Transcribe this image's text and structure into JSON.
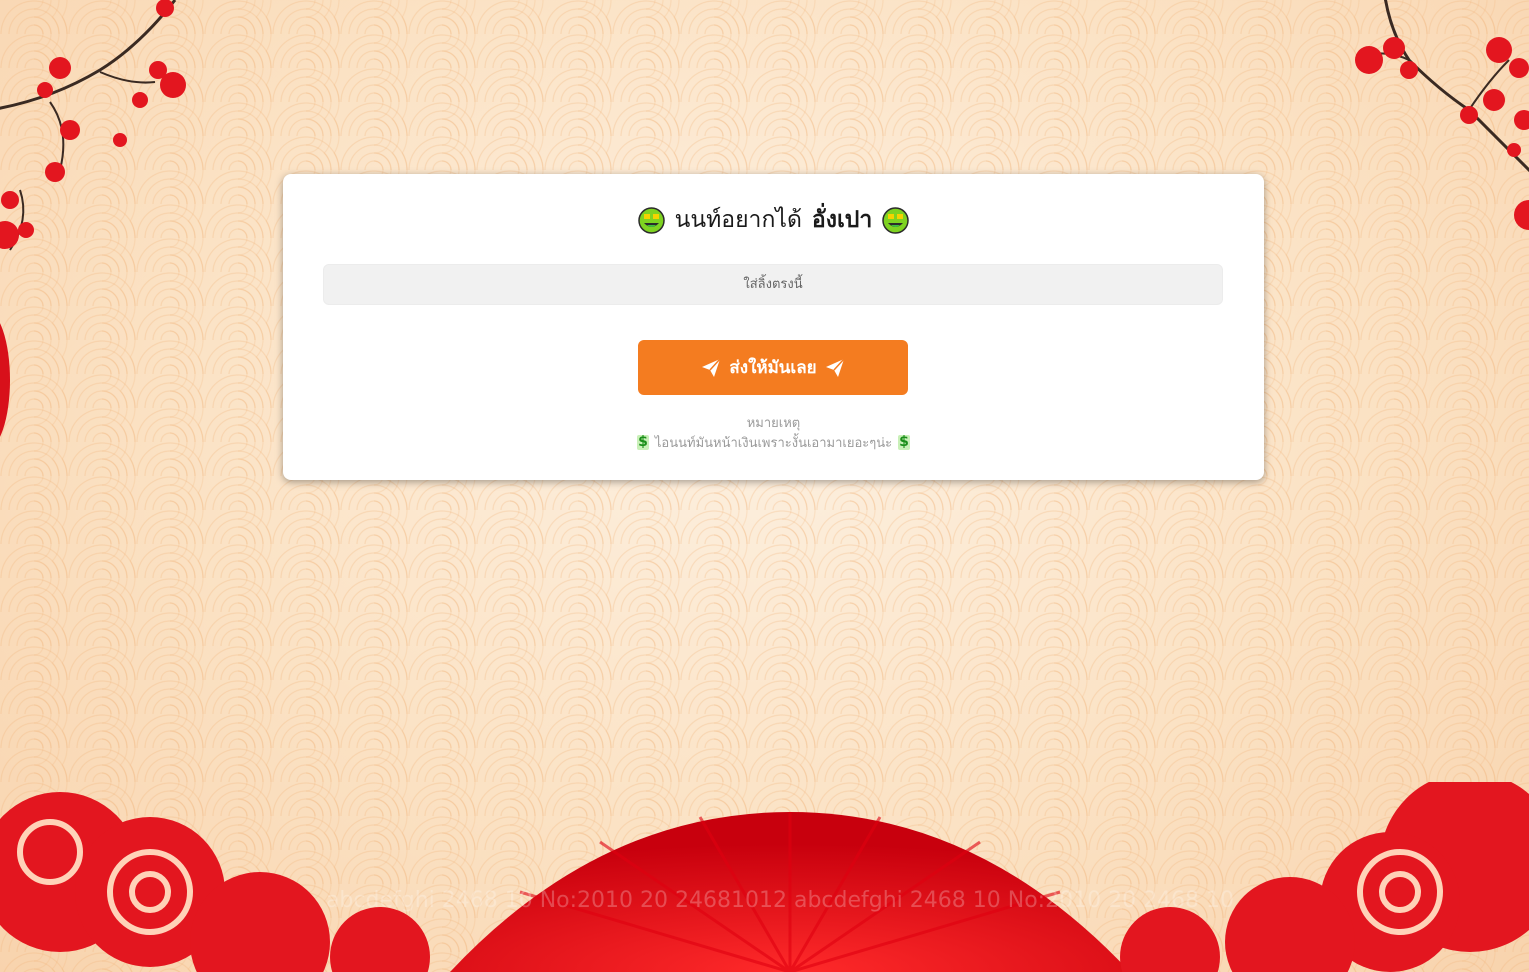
{
  "title": {
    "prefix": "นนท์อยากได้",
    "highlight": "อั่งเปา"
  },
  "input": {
    "placeholder": "ใส่ลิ้งตรงนี้",
    "value": ""
  },
  "send_button": {
    "label": "ส่งให้มันเลย",
    "icon": "paper-plane-icon"
  },
  "note": {
    "title": "หมายเหตุ",
    "text": "ไอนนท์มันหน้าเงินเพราะงั้นเอามาเยอะๆน่ะ",
    "icon": "heavy-dollar-sign-icon"
  },
  "watermark": {
    "text": "abcdefghi 2468 10 No:2010 20 24681012 abcdefghi 2468 10 No:2010 20 2468 10"
  },
  "colors": {
    "accent": "#f47c20",
    "card": "#ffffff",
    "background": "#fbe1c1"
  }
}
